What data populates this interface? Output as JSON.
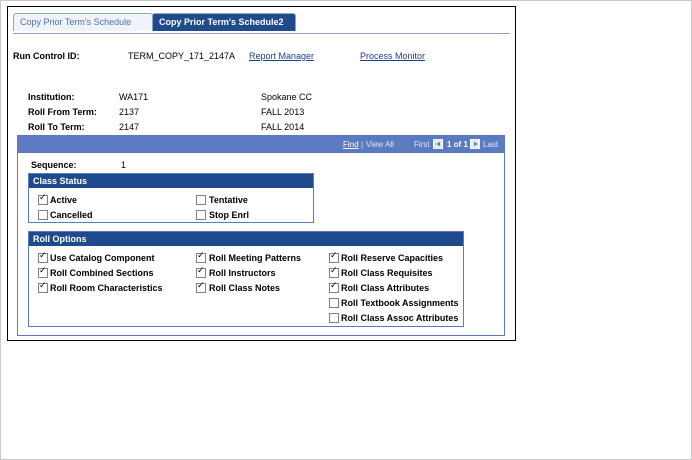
{
  "tabs": [
    {
      "label": "Copy Prior Term's Schedule"
    },
    {
      "label": "Copy Prior Term's Schedule2"
    }
  ],
  "header": {
    "run_control_label": "Run Control ID:",
    "run_control_value": "TERM_COPY_171_2147A",
    "report_manager": "Report Manager",
    "process_monitor": "Process Monitor"
  },
  "info": {
    "institution_label": "Institution:",
    "institution_value": "WA171",
    "institution_desc": "Spokane CC",
    "roll_from_label": "Roll From Term:",
    "roll_from_value": "2137",
    "roll_from_desc": "FALL 2013",
    "roll_to_label": "Roll To Term:",
    "roll_to_value": "2147",
    "roll_to_desc": "FALL 2014"
  },
  "navbar": {
    "find": "Find",
    "sep": "|",
    "view_all": "View All",
    "first": "First",
    "range": "1 of 1",
    "last": "Last"
  },
  "sequence": {
    "label": "Sequence:",
    "value": "1"
  },
  "class_status": {
    "title": "Class Status",
    "items": [
      {
        "label": "Active",
        "checked": true
      },
      {
        "label": "Tentative",
        "checked": false
      },
      {
        "label": "Cancelled",
        "checked": false
      },
      {
        "label": "Stop Enrl",
        "checked": false
      }
    ]
  },
  "roll_options": {
    "title": "Roll Options",
    "items": [
      {
        "label": "Use Catalog Component",
        "checked": true
      },
      {
        "label": "Roll Combined Sections",
        "checked": true
      },
      {
        "label": "Roll Room Characteristics",
        "checked": true
      },
      {
        "label": "Roll Meeting Patterns",
        "checked": true
      },
      {
        "label": "Roll Instructors",
        "checked": true
      },
      {
        "label": "Roll Class Notes",
        "checked": true
      },
      {
        "label": "Roll Reserve Capacities",
        "checked": true
      },
      {
        "label": "Roll Class Requisites",
        "checked": true
      },
      {
        "label": "Roll Class Attributes",
        "checked": true
      },
      {
        "label": "Roll Textbook Assignments",
        "checked": false
      },
      {
        "label": "Roll Class Assoc Attributes",
        "checked": false
      }
    ]
  }
}
